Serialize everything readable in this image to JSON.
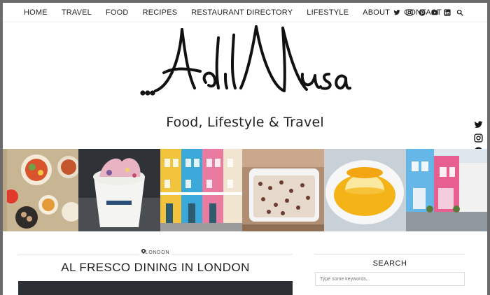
{
  "nav": {
    "items": [
      "HOME",
      "TRAVEL",
      "FOOD",
      "RECIPES",
      "RESTAURANT DIRECTORY",
      "LIFESTYLE",
      "ABOUT",
      "CONTACT"
    ],
    "social_icons": [
      "twitter-icon",
      "instagram-icon",
      "pinterest-icon",
      "youtube-icon",
      "linkedin-icon",
      "search-icon"
    ]
  },
  "header": {
    "logo_text": "Adil Musa",
    "tagline": "Food, Lifestyle & Travel"
  },
  "side_social": [
    "twitter-icon",
    "instagram-icon",
    "pinterest-icon",
    "youtube-icon",
    "linkedin-icon"
  ],
  "gallery": [
    {
      "name": "food-spread-photo",
      "colors": [
        "#c9b89d",
        "#d9542d",
        "#f0e4cc"
      ]
    },
    {
      "name": "ice-cream-photo",
      "colors": [
        "#3c3f46",
        "#e9b9c4",
        "#ffffff"
      ]
    },
    {
      "name": "colourful-houses-photo",
      "colors": [
        "#3aa9d9",
        "#f2c33d",
        "#e97aa0"
      ]
    },
    {
      "name": "baking-tray-photo",
      "colors": [
        "#c8a58a",
        "#7a4b3b",
        "#efe6dd"
      ]
    },
    {
      "name": "flan-photo",
      "colors": [
        "#cfd6dd",
        "#f4b316",
        "#fbe9a2"
      ]
    },
    {
      "name": "mews-street-photo",
      "colors": [
        "#64b7e6",
        "#e75f8f",
        "#9aa3ab"
      ]
    }
  ],
  "post": {
    "category": "LONDON",
    "title": "AL FRESCO DINING IN LONDON"
  },
  "sidebar": {
    "widget_title": "SEARCH",
    "search_placeholder": "Type some keywords..."
  },
  "colors": {
    "frame": "#6b6b6b",
    "text": "#222222"
  }
}
